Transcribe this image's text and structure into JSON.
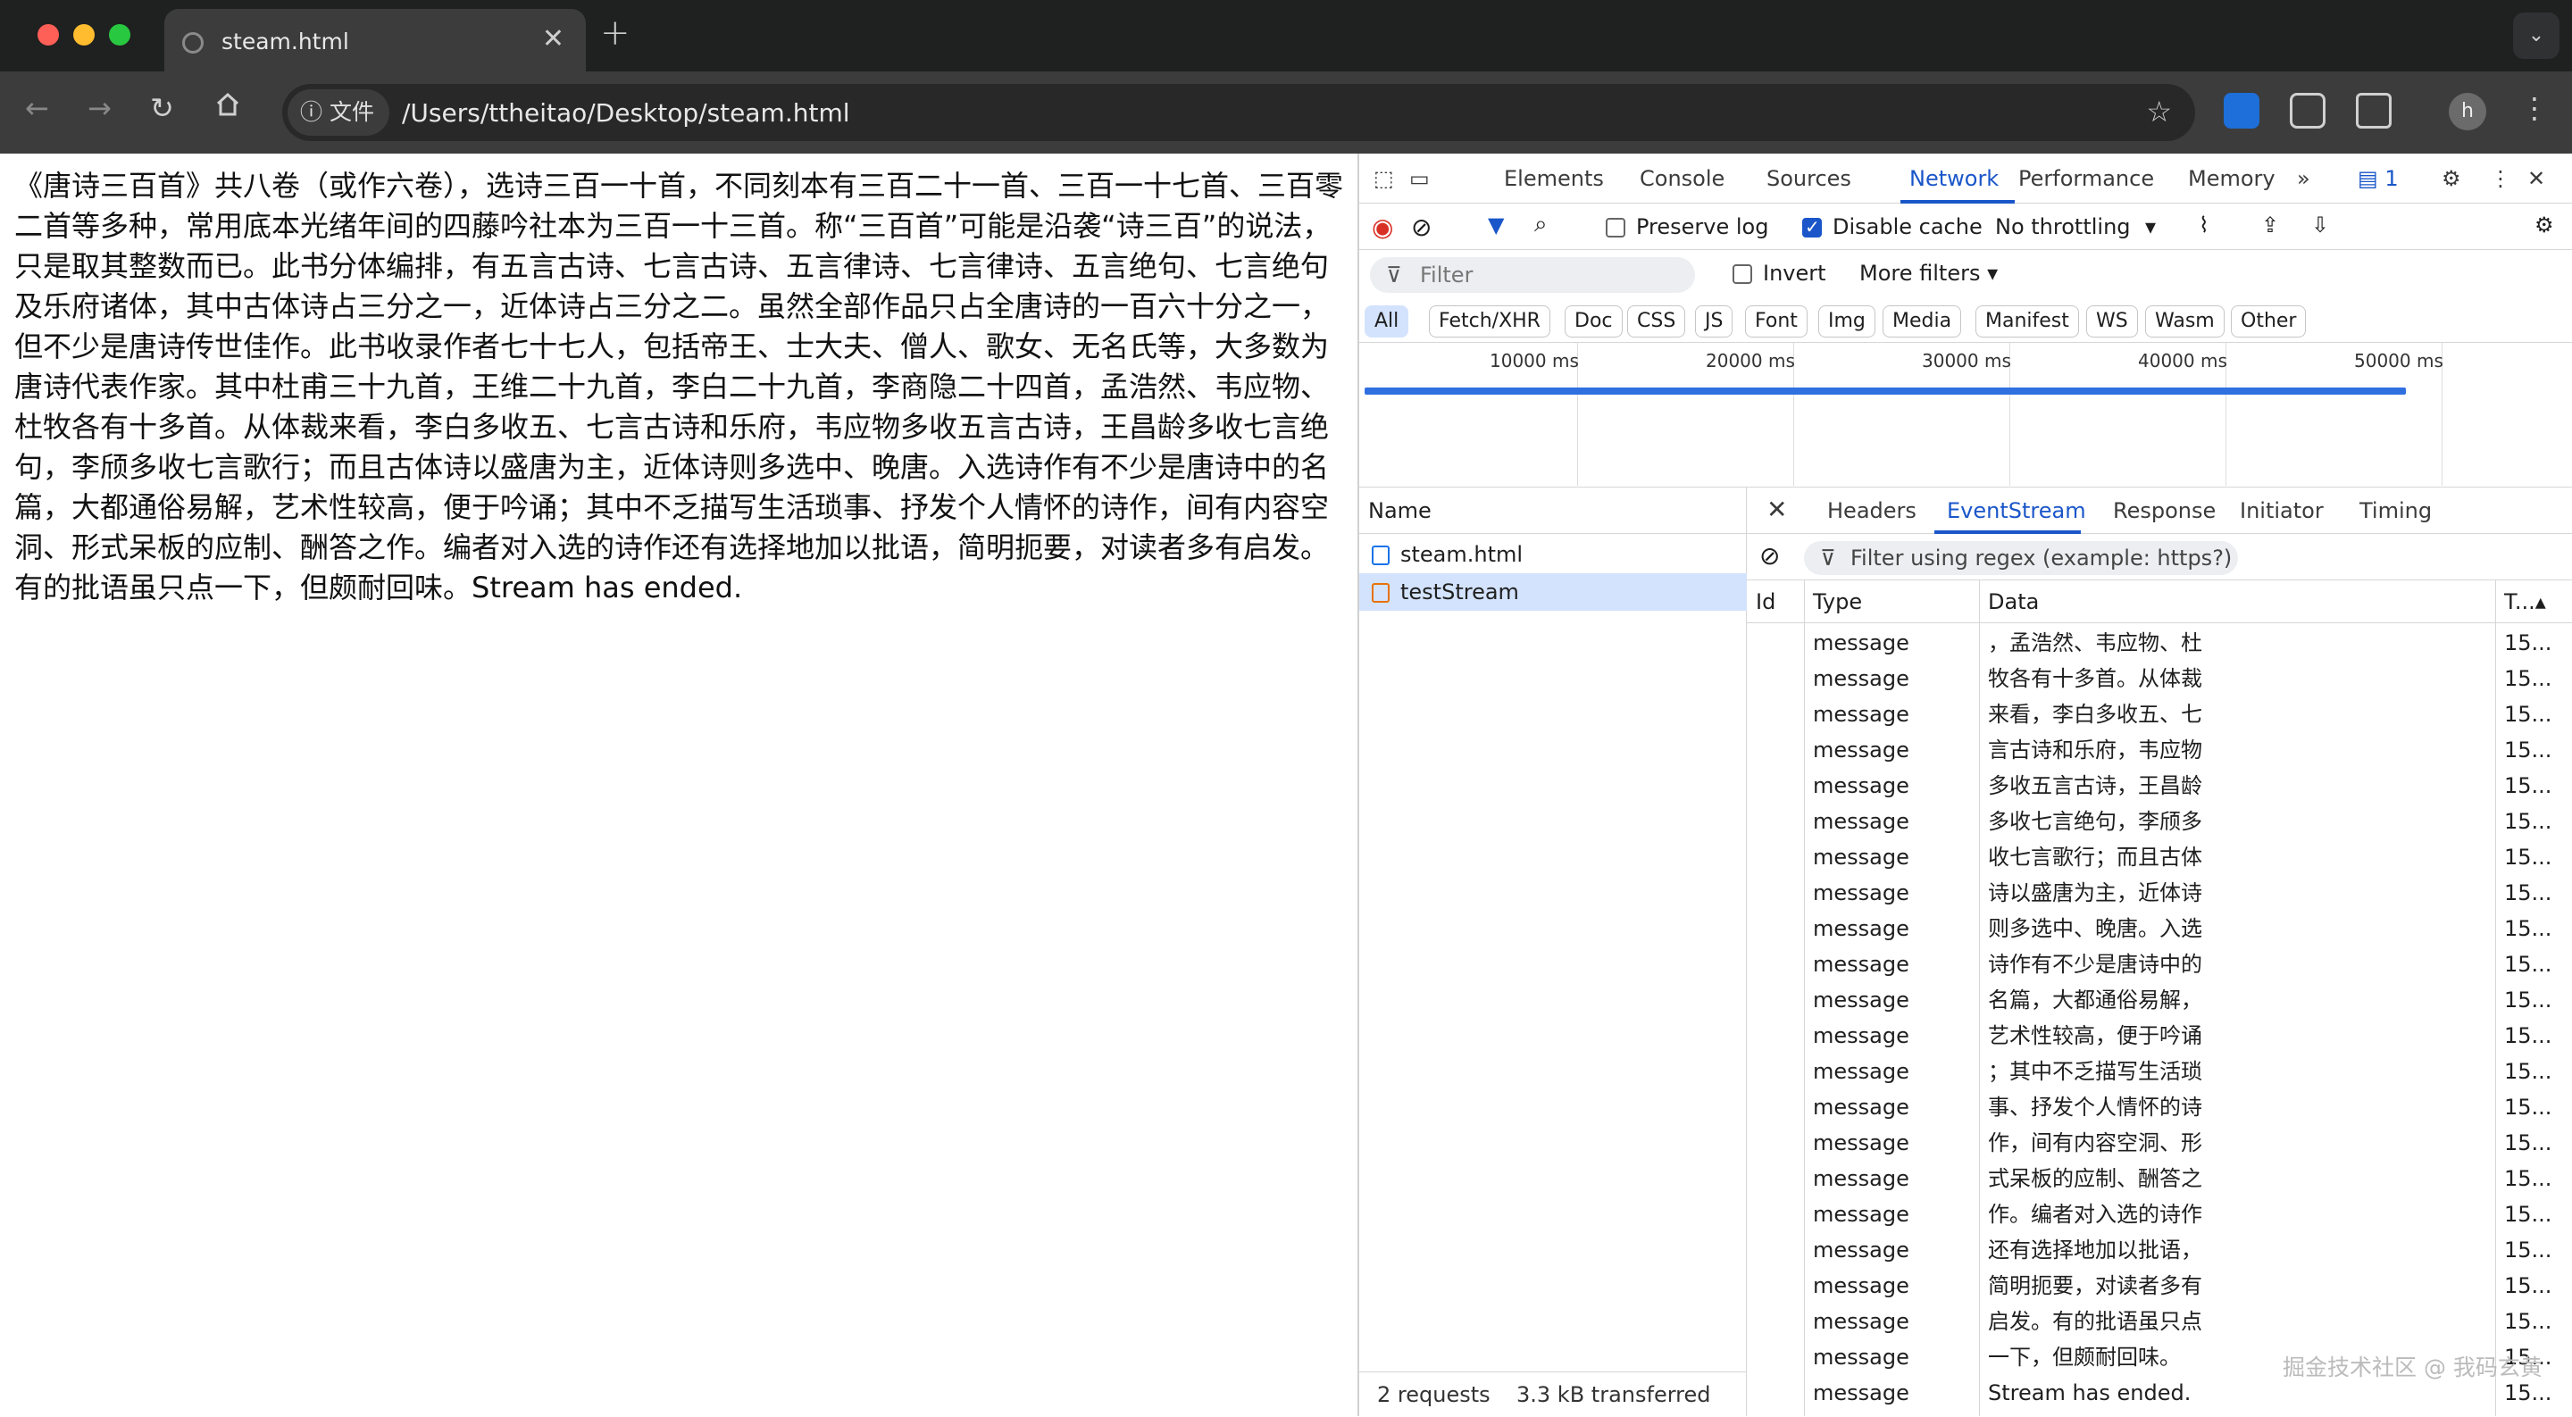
{
  "browser": {
    "tab_title": "steam.html",
    "new_tab_label": "+",
    "site_chip": "文件",
    "url": "/Users/ttheitao/Desktop/steam.html",
    "avatar_letter": "h"
  },
  "page": {
    "text": "《唐诗三百首》共八卷（或作六卷），选诗三百一十首，不同刻本有三百二十一首、三百一十七首、三百零二首等多种，常用底本光绪年间的四藤吟社本为三百一十三首。称“三百首”可能是沿袭“诗三百”的说法，只是取其整数而已。此书分体编排，有五言古诗、七言古诗、五言律诗、七言律诗、五言绝句、七言绝句及乐府诸体，其中古体诗占三分之一，近体诗占三分之二。虽然全部作品只占全唐诗的一百六十分之一，但不少是唐诗传世佳作。此书收录作者七十七人，包括帝王、士大夫、僧人、歌女、无名氏等，大多数为唐诗代表作家。其中杜甫三十九首，王维二十九首，李白二十九首，李商隐二十四首，孟浩然、韦应物、杜牧各有十多首。从体裁来看，李白多收五、七言古诗和乐府，韦应物多收五言古诗，王昌龄多收七言绝句，李颀多收七言歌行；而且古体诗以盛唐为主，近体诗则多选中、晚唐。入选诗作有不少是唐诗中的名篇，大都通俗易解，艺术性较高，便于吟诵；其中不乏描写生活琐事、抒发个人情怀的诗作，间有内容空洞、形式呆板的应制、酬答之作。编者对入选的诗作还有选择地加以批语，简明扼要，对读者多有启发。有的批语虽只点一下，但颇耐回味。Stream has ended."
  },
  "watermark": "掘金技术社区 @ 我码玄黄",
  "devtools": {
    "tabs": [
      "Elements",
      "Console",
      "Sources",
      "Network",
      "Performance",
      "Memory"
    ],
    "active_tab": "Network",
    "more_tabs": "»",
    "issues_count": "1",
    "preserve_log": "Preserve log",
    "disable_cache": "Disable cache",
    "throttling": "No throttling",
    "filter_placeholder": "Filter",
    "invert": "Invert",
    "more_filters": "More filters",
    "type_filters": [
      "All",
      "Fetch/XHR",
      "Doc",
      "CSS",
      "JS",
      "Font",
      "Img",
      "Media",
      "Manifest",
      "WS",
      "Wasm",
      "Other"
    ],
    "timeline_ticks": [
      "10000 ms",
      "20000 ms",
      "30000 ms",
      "40000 ms",
      "50000 ms"
    ],
    "name_header": "Name",
    "requests": [
      {
        "name": "steam.html",
        "type": "document"
      },
      {
        "name": "testStream",
        "type": "eventsource",
        "selected": true
      }
    ],
    "status": {
      "requests": "2 requests",
      "transferred": "3.3 kB transferred"
    },
    "detail_tabs": [
      "Headers",
      "EventStream",
      "Response",
      "Initiator",
      "Timing"
    ],
    "active_detail_tab": "EventStream",
    "es_filter_placeholder": "Filter using regex (example: https?)",
    "columns": {
      "id": "Id",
      "type": "Type",
      "data": "Data",
      "time": "T..."
    },
    "events": [
      {
        "type": "message",
        "data": "，孟浩然、韦应物、杜",
        "time": "15..."
      },
      {
        "type": "message",
        "data": "牧各有十多首。从体裁",
        "time": "15..."
      },
      {
        "type": "message",
        "data": "来看，李白多收五、七",
        "time": "15..."
      },
      {
        "type": "message",
        "data": "言古诗和乐府，韦应物",
        "time": "15..."
      },
      {
        "type": "message",
        "data": "多收五言古诗，王昌龄",
        "time": "15..."
      },
      {
        "type": "message",
        "data": "多收七言绝句，李颀多",
        "time": "15..."
      },
      {
        "type": "message",
        "data": "收七言歌行；而且古体",
        "time": "15..."
      },
      {
        "type": "message",
        "data": "诗以盛唐为主，近体诗",
        "time": "15..."
      },
      {
        "type": "message",
        "data": "则多选中、晚唐。入选",
        "time": "15..."
      },
      {
        "type": "message",
        "data": "诗作有不少是唐诗中的",
        "time": "15..."
      },
      {
        "type": "message",
        "data": "名篇，大都通俗易解，",
        "time": "15..."
      },
      {
        "type": "message",
        "data": "艺术性较高，便于吟诵",
        "time": "15..."
      },
      {
        "type": "message",
        "data": "；其中不乏描写生活琐",
        "time": "15..."
      },
      {
        "type": "message",
        "data": "事、抒发个人情怀的诗",
        "time": "15..."
      },
      {
        "type": "message",
        "data": "作，间有内容空洞、形",
        "time": "15..."
      },
      {
        "type": "message",
        "data": "式呆板的应制、酬答之",
        "time": "15..."
      },
      {
        "type": "message",
        "data": "作。编者对入选的诗作",
        "time": "15..."
      },
      {
        "type": "message",
        "data": "还有选择地加以批语，",
        "time": "15..."
      },
      {
        "type": "message",
        "data": "简明扼要，对读者多有",
        "time": "15..."
      },
      {
        "type": "message",
        "data": "启发。有的批语虽只点",
        "time": "15..."
      },
      {
        "type": "message",
        "data": "一下，但颇耐回味。",
        "time": "15..."
      },
      {
        "type": "message",
        "data": "Stream has ended.",
        "time": "15..."
      }
    ],
    "colors": {
      "accent": "#1a56c9",
      "selected_row": "#d3e3fd",
      "record": "#d93025",
      "eventsource_icon": "#e8710a",
      "doc_icon": "#1a73e8"
    }
  }
}
